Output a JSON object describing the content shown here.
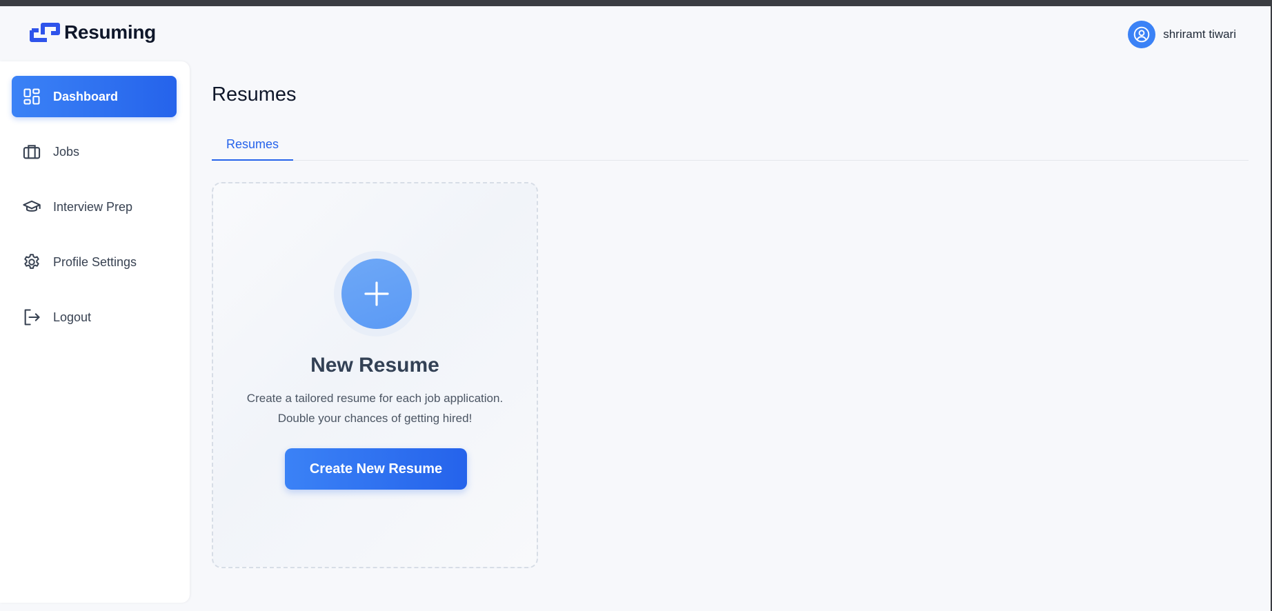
{
  "app": {
    "name": "Resuming"
  },
  "header": {
    "user_name": "shriramt tiwari"
  },
  "sidebar": {
    "items": [
      {
        "label": "Dashboard",
        "icon": "dashboard-grid-icon",
        "active": true
      },
      {
        "label": "Jobs",
        "icon": "briefcase-icon",
        "active": false
      },
      {
        "label": "Interview Prep",
        "icon": "graduation-cap-icon",
        "active": false
      },
      {
        "label": "Profile Settings",
        "icon": "gear-icon",
        "active": false
      },
      {
        "label": "Logout",
        "icon": "logout-icon",
        "active": false
      }
    ]
  },
  "main": {
    "title": "Resumes",
    "tabs": [
      {
        "label": "Resumes",
        "active": true
      }
    ],
    "new_resume_card": {
      "icon": "plus-icon",
      "title": "New Resume",
      "description_line1": "Create a tailored resume for each job application.",
      "description_line2": "Double your chances of getting hired!",
      "button_label": "Create New Resume"
    }
  },
  "colors": {
    "accent": "#2563eb",
    "accent_light": "#3b82f6",
    "background": "#f7f8fb",
    "sidebar_bg": "#ffffff"
  }
}
